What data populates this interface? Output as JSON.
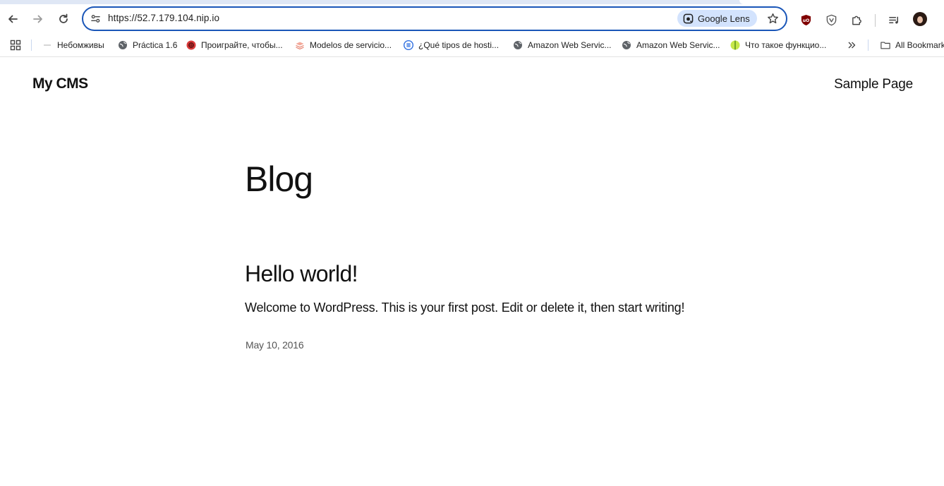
{
  "browser": {
    "url": "https://52.7.179.104.nip.io",
    "lens_label": "Google Lens",
    "bookmarks": [
      {
        "label": "Небомживы",
        "icon": "dash-icon"
      },
      {
        "label": "Práctica 1.6",
        "icon": "globe-icon"
      },
      {
        "label": "Проиграйте, чтобы...",
        "icon": "red-circle-icon"
      },
      {
        "label": "Modelos de servicio...",
        "icon": "layers-icon"
      },
      {
        "label": "¿Qué tipos de hosti...",
        "icon": "doc-icon"
      },
      {
        "label": "Amazon Web Servic...",
        "icon": "globe-icon"
      },
      {
        "label": "Amazon Web Servic...",
        "icon": "globe-icon"
      },
      {
        "label": "Что такое функцио...",
        "icon": "ball-icon"
      }
    ],
    "all_bookmarks_label": "All Bookmarks",
    "accent_color": "#1a56b8"
  },
  "site": {
    "title": "My CMS",
    "nav_link": "Sample Page"
  },
  "main": {
    "heading": "Blog",
    "post": {
      "title": "Hello world!",
      "excerpt": "Welcome to WordPress. This is your first post. Edit or delete it, then start writing!",
      "date": "May 10, 2016"
    }
  }
}
